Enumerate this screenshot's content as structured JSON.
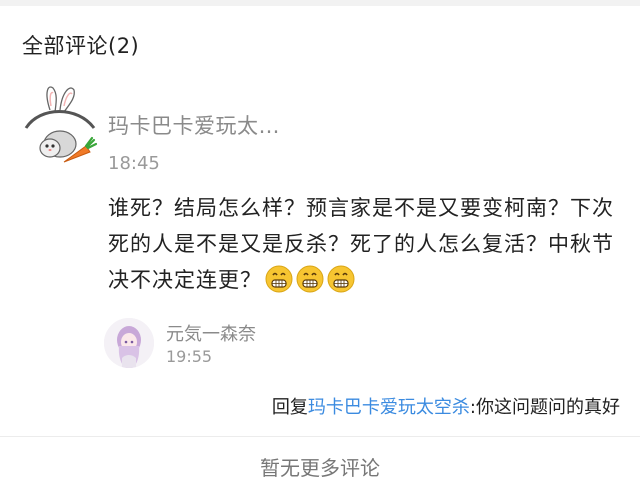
{
  "section": {
    "title": "全部评论(2)"
  },
  "comment": {
    "username": "玛卡巴卡爱玩太…",
    "time": "18:45",
    "text": "谁死？结局怎么样？预言家是不是又要变柯南？下次死的人是不是又是反杀？死了的人怎么复活？中秋节决不决定连更？",
    "emojis": [
      "grin-emoji",
      "grin-emoji",
      "grin-emoji"
    ]
  },
  "reply": {
    "username": "元気一森奈",
    "time": "19:55",
    "prefix": "回复",
    "target": "玛卡巴卡爱玩太空杀",
    "text": ":你这问题问的真好"
  },
  "footer": {
    "no_more": "暂无更多评论"
  },
  "colors": {
    "link": "#3b8be0",
    "meta": "#8a8a8a"
  }
}
